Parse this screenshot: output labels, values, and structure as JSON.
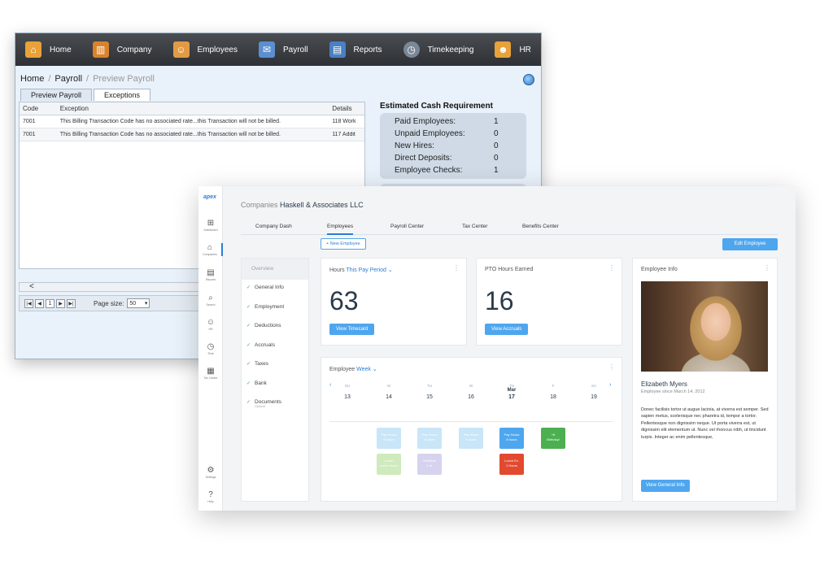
{
  "legacy": {
    "nav": [
      {
        "label": "Home",
        "icon": "house-icon"
      },
      {
        "label": "Company",
        "icon": "building-icon"
      },
      {
        "label": "Employees",
        "icon": "people-icon"
      },
      {
        "label": "Payroll",
        "icon": "payroll-icon"
      },
      {
        "label": "Reports",
        "icon": "report-icon"
      },
      {
        "label": "Timekeeping",
        "icon": "clock-icon"
      },
      {
        "label": "HR",
        "icon": "hr-icon"
      }
    ],
    "breadcrumb": {
      "home": "Home",
      "payroll": "Payroll",
      "current": "Preview Payroll"
    },
    "tabs": [
      "Preview Payroll",
      "Exceptions"
    ],
    "grid": {
      "headers": {
        "code": "Code",
        "exception": "Exception",
        "details": "Details"
      },
      "rows": [
        {
          "code": "7001",
          "exception": "This Billing Transaction Code has no associated rate...this Transaction will not be billed.",
          "details": "118 Work"
        },
        {
          "code": "7001",
          "exception": "This Billing Transaction Code has no associated rate...this Transaction will not be billed.",
          "details": "117 Addit"
        }
      ]
    },
    "scroll_arrow": "<",
    "pager": {
      "page": "1",
      "size_label": "Page size:",
      "size": "50"
    },
    "cash": {
      "title": "Estimated Cash Requirement",
      "rows": [
        {
          "label": "Paid Employees:",
          "value": "1"
        },
        {
          "label": "Unpaid Employees:",
          "value": "0"
        },
        {
          "label": "New Hires:",
          "value": "0"
        },
        {
          "label": "Direct Deposits:",
          "value": "0"
        },
        {
          "label": "Employee Checks:",
          "value": "1"
        }
      ]
    }
  },
  "modern": {
    "logo": "apex",
    "sidebar": [
      {
        "label": "Dashboard",
        "icon": "dashboard-icon",
        "glyph": "⊞"
      },
      {
        "label": "Companies",
        "icon": "companies-icon",
        "glyph": "⌂"
      },
      {
        "label": "Reports",
        "icon": "reports-icon",
        "glyph": "▤"
      },
      {
        "label": "Search",
        "icon": "search-icon",
        "glyph": "⌕"
      },
      {
        "label": "HR",
        "icon": "hr-icon",
        "glyph": "☺"
      },
      {
        "label": "Time",
        "icon": "clock-icon",
        "glyph": "◷"
      },
      {
        "label": "Tax Center",
        "icon": "tax-icon",
        "glyph": "▦"
      },
      {
        "label": "Settings",
        "icon": "gear-icon",
        "glyph": "⚙"
      },
      {
        "label": "Help",
        "icon": "help-icon",
        "glyph": "?"
      }
    ],
    "company_prefix": "Companies",
    "company_name": "Haskell & Associates LLC",
    "tabs": [
      "Company Dash",
      "Employees",
      "Payroll Center",
      "Tax Center",
      "Benefits Center"
    ],
    "new_employee": "+ New Employee",
    "edit_employee": "Edit Employee",
    "steps": {
      "overview": "Overview",
      "items": [
        "General Info",
        "Employment",
        "Deductions",
        "Accruals",
        "Taxes",
        "Bank",
        "Documents"
      ],
      "documents_sub": "Optional"
    },
    "hours": {
      "title": "Hours",
      "period": "This Pay Period",
      "value": "63",
      "button": "View Timecard"
    },
    "pto": {
      "title": "PTO Hours Earned",
      "value": "16",
      "button": "View Accruals"
    },
    "week": {
      "title": "Employee",
      "period": "Week",
      "prev": "‹",
      "next": "›",
      "days": [
        {
          "dn": "SU",
          "mo": "",
          "dd": "13"
        },
        {
          "dn": "M",
          "mo": "",
          "dd": "14"
        },
        {
          "dn": "TU",
          "mo": "",
          "dd": "15"
        },
        {
          "dn": "W",
          "mo": "",
          "dd": "16"
        },
        {
          "dn": "TH",
          "mo": "Mar",
          "dd": "17"
        },
        {
          "dn": "F",
          "mo": "",
          "dd": "18"
        },
        {
          "dn": "SA",
          "mo": "",
          "dd": "19"
        }
      ],
      "events": [
        {
          "l1": "Pay Hours",
          "l2": "8 hours",
          "color": "#c9e5f8"
        },
        {
          "l1": "Pay Hours",
          "l2": "8 hours",
          "color": "#c9e5f8"
        },
        {
          "l1": "Pay Hours",
          "l2": "8 hours",
          "color": "#c9e5f8"
        },
        {
          "l1": "Pay Hours",
          "l2": "8 hours",
          "color": "#4ea6ee"
        },
        {
          "l1": "+8",
          "l2": "Birthday!",
          "color": "#4caf50"
        },
        {
          "l1": "Lunch",
          "l2": "Lunch Hours",
          "color": "#cfeabd"
        },
        {
          "l1": "Overtime",
          "l2": "1 hr",
          "color": "#d6d3ef"
        },
        {
          "l1": "Lunch Ex.",
          "l2": "1 Hours",
          "color": "#e24a2f"
        }
      ]
    },
    "employee": {
      "title": "Employee Info",
      "name": "Elizabeth Myers",
      "since": "Employee since March 14, 2012",
      "bio": "Donec facilisis tortor ut augue lacinia, at viverra est semper. Sed sapien metus, scelerisque nec pharetra id, tempor a tortor. Pellentesque non dignissim neque. Ut porta viverra est, ut dignissim elit elementum ut. Nunc vel rhoncus nibh, ut tincidunt turpis. Integer ac enim pellentesque,",
      "button": "View General Info"
    }
  }
}
